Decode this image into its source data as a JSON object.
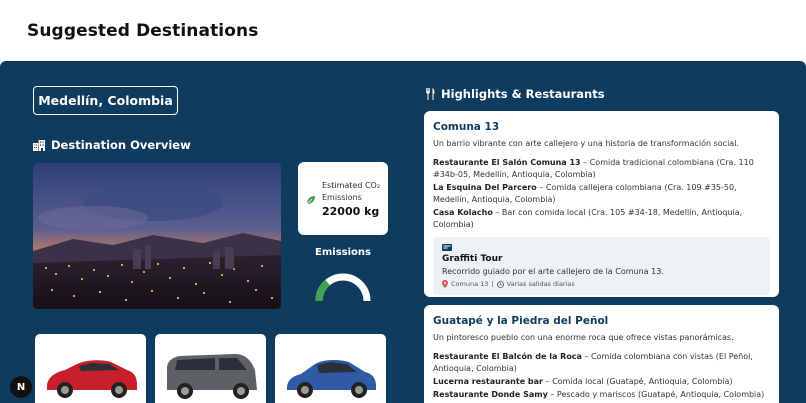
{
  "header": {
    "title": "Suggested Destinations"
  },
  "destination": {
    "city": "Medellín, Colombia"
  },
  "overview": {
    "heading": "Destination Overview"
  },
  "emissions": {
    "label": "Estimated CO₂ Emissions",
    "value": "22000 kg",
    "title": "Emissions",
    "gauge_fraction": 0.28,
    "gauge_color": "#3fa34d"
  },
  "highlights": {
    "heading": "Highlights & Restaurants",
    "cards": [
      {
        "title": "Comuna 13",
        "description": "Un barrio vibrante con arte callejero y una historia de transformación social.",
        "restaurants": [
          {
            "name": "Restaurante El Salón Comuna 13",
            "details": " – Comida tradicional colombiana (Cra. 110 #34b-05, Medellín, Antioquia, Colombia)"
          },
          {
            "name": "La Esquina Del Parcero",
            "details": " – Comida callejera colombiana (Cra. 109 #35-50, Medellín, Antioquia, Colombia)"
          },
          {
            "name": "Casa Kolacho",
            "details": " – Bar con comida local (Cra. 105 #34-18, Medellín, Antioquia, Colombia)"
          }
        ],
        "tour": {
          "title": "Graffiti Tour",
          "description": "Recorrido guiado por el arte callejero de la Comuna 13.",
          "location": "Comuna 13",
          "separator": "|",
          "schedule": "Varias salidas diarias"
        }
      },
      {
        "title": "Guatapé y la Piedra del Peñol",
        "description": "Un pintoresco pueblo con una enorme roca que ofrece vistas panorámicas.",
        "restaurants": [
          {
            "name": "Restaurante El Balcón de la Roca",
            "details": " – Comida colombiana con vistas (El Peñol, Antioquia, Colombia)"
          },
          {
            "name": "Lucerna restaurante bar",
            "details": " – Comida local (Guatapé, Antioquia, Colombia)"
          },
          {
            "name": "Restaurante Donde Samy",
            "details": " – Pescado y mariscos (Guatapé, Antioquia, Colombia)"
          }
        ]
      }
    ]
  },
  "cars": [
    {
      "icon": "red-suv-image",
      "color": "#c8202a"
    },
    {
      "icon": "gray-van-image",
      "color": "#5d6166"
    },
    {
      "icon": "blue-hatchback-image",
      "color": "#2f5aa6"
    }
  ],
  "floating": {
    "label": "N"
  }
}
